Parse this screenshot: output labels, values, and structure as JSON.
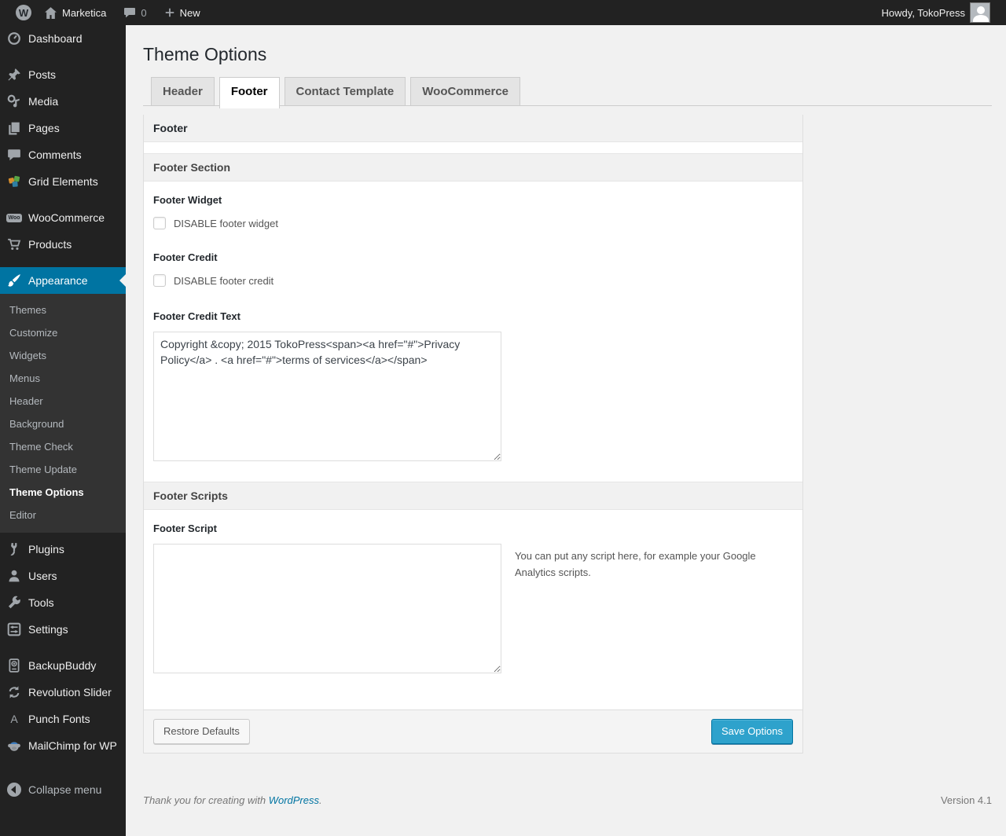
{
  "colors": {
    "accent": "#0074a2",
    "primary_button": "#2ea2cc",
    "admin_bar_bg": "#222222",
    "submenu_bg": "#333333"
  },
  "admin_bar": {
    "wp_logo_letter": "W",
    "site_name": "Marketica",
    "comment_count": "0",
    "new_label": "New",
    "howdy": "Howdy, TokoPress"
  },
  "sidebar": {
    "menu": [
      {
        "label": "Dashboard"
      },
      {
        "label": "Posts"
      },
      {
        "label": "Media"
      },
      {
        "label": "Pages"
      },
      {
        "label": "Comments"
      },
      {
        "label": "Grid Elements"
      },
      {
        "label": "WooCommerce"
      },
      {
        "label": "Products"
      },
      {
        "label": "Appearance"
      },
      {
        "label": "Plugins"
      },
      {
        "label": "Users"
      },
      {
        "label": "Tools"
      },
      {
        "label": "Settings"
      },
      {
        "label": "BackupBuddy"
      },
      {
        "label": "Revolution Slider"
      },
      {
        "label": "Punch Fonts"
      },
      {
        "label": "MailChimp for WP"
      }
    ],
    "woo_badge": "Woo",
    "punch_fonts_letter": "A",
    "submenu": [
      "Themes",
      "Customize",
      "Widgets",
      "Menus",
      "Header",
      "Background",
      "Theme Check",
      "Theme Update",
      "Theme Options",
      "Editor"
    ],
    "collapse_label": "Collapse menu"
  },
  "page": {
    "title": "Theme Options",
    "tabs": [
      "Header",
      "Footer",
      "Contact Template",
      "WooCommerce"
    ]
  },
  "panel": {
    "title": "Footer",
    "section_footer": "Footer Section",
    "footer_widget_label": "Footer Widget",
    "footer_widget_checkbox_label": "DISABLE footer widget",
    "footer_credit_label": "Footer Credit",
    "footer_credit_checkbox_label": "DISABLE footer credit",
    "footer_credit_text_label": "Footer Credit Text",
    "footer_credit_text_value": "Copyright &copy; 2015 TokoPress<span><a href=\"#\">Privacy Policy</a> . <a href=\"#\">terms of services</a></span>",
    "section_scripts": "Footer Scripts",
    "footer_script_label": "Footer Script",
    "footer_script_value": "",
    "footer_script_note": "You can put any script here, for example your Google Analytics scripts.",
    "restore_button": "Restore Defaults",
    "save_button": "Save Options"
  },
  "page_footer": {
    "thanks_prefix": "Thank you for creating with",
    "wordpress_link": "WordPress",
    "period": ".",
    "version": "Version 4.1"
  }
}
